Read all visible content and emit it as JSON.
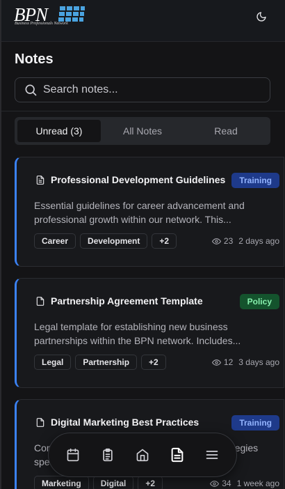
{
  "brand": {
    "logo_text": "BPN",
    "logo_subtitle": "Business Professionals Network"
  },
  "page": {
    "title": "Notes"
  },
  "search": {
    "placeholder": "Search notes..."
  },
  "tabs": [
    {
      "label": "Unread (3)",
      "active": true
    },
    {
      "label": "All Notes",
      "active": false
    },
    {
      "label": "Read",
      "active": false
    }
  ],
  "notes": [
    {
      "title": "Professional Development Guidelines",
      "badge": "Training",
      "badge_type": "training",
      "icon": "document-text-icon",
      "description": "Essential guidelines for career advancement and professional growth within our network. This...",
      "tags": [
        "Career",
        "Development",
        "+2"
      ],
      "views": "23",
      "time": "2 days ago"
    },
    {
      "title": "Partnership Agreement Template",
      "badge": "Policy",
      "badge_type": "policy",
      "icon": "document-icon",
      "description": "Legal template for establishing new business partnerships within the BPN network. Includes...",
      "tags": [
        "Legal",
        "Partnership",
        "+2"
      ],
      "views": "12",
      "time": "3 days ago"
    },
    {
      "title": "Digital Marketing Best Practices",
      "badge": "Training",
      "badge_type": "training",
      "icon": "document-icon",
      "description": "Comprehensive guide to digital marketing strategies specifically for BPN members and their...",
      "tags": [
        "Marketing",
        "Digital",
        "+2"
      ],
      "views": "34",
      "time": "1 week ago"
    }
  ],
  "nav": [
    "calendar-icon",
    "clipboard-icon",
    "home-icon",
    "notes-icon",
    "menu-icon"
  ],
  "colors": {
    "accent": "#3b82f6",
    "training_bg": "#1e3a8a",
    "policy_bg": "#14532d"
  }
}
